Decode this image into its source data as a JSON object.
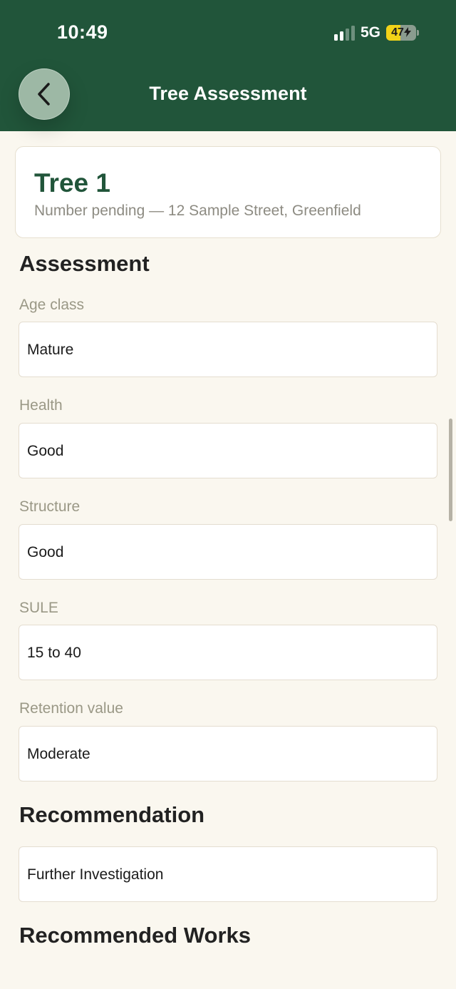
{
  "status_bar": {
    "time": "10:49",
    "network": "5G",
    "battery_text": "47",
    "battery_level": 0.47,
    "signal_bars_active": 2,
    "signal_bars_total": 4
  },
  "header": {
    "title": "Tree Assessment",
    "back_icon": "chevron-left-icon"
  },
  "tree_card": {
    "title": "Tree 1",
    "subtitle": "Number pending — 12 Sample Street, Greenfield"
  },
  "assessment": {
    "heading": "Assessment",
    "fields": [
      {
        "label": "Age class",
        "value": "Mature"
      },
      {
        "label": "Health",
        "value": "Good"
      },
      {
        "label": "Structure",
        "value": "Good"
      },
      {
        "label": "SULE",
        "value": "15 to 40"
      },
      {
        "label": "Retention value",
        "value": "Moderate"
      }
    ]
  },
  "recommendation": {
    "heading": "Recommendation",
    "value": "Further Investigation"
  },
  "recommended_works": {
    "heading": "Recommended Works"
  },
  "colors": {
    "header_bg": "#21553a",
    "page_bg": "#faf7ef",
    "accent_green": "#21553a",
    "battery_yellow": "#f2d318"
  }
}
